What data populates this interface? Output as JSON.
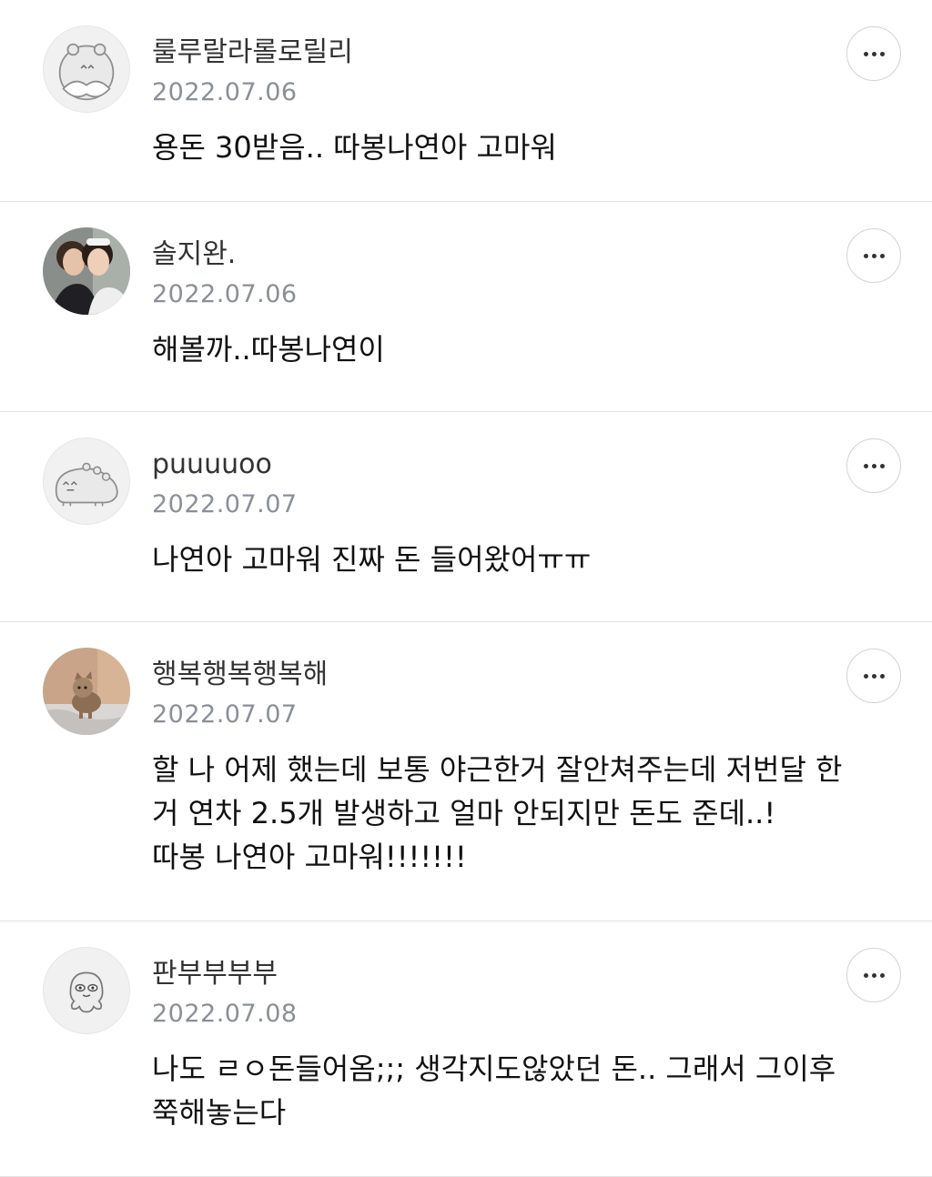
{
  "comments": [
    {
      "username": "룰루랄라롤로릴리",
      "date": "2022.07.06",
      "text_lines": [
        "용돈 30받음.. 따봉나연아 고마워"
      ],
      "avatar": "hamster-default-avatar"
    },
    {
      "username": "솔지완.",
      "date": "2022.07.06",
      "text_lines": [
        "해볼까..따봉나연이"
      ],
      "avatar": "photo-two-people-avatar"
    },
    {
      "username": "puuuuoo",
      "date": "2022.07.07",
      "text_lines": [
        "나연아 고마워 진짜 돈 들어왔어ㅠㅠ"
      ],
      "avatar": "hedgehog-default-avatar"
    },
    {
      "username": "행복행복행복해",
      "date": "2022.07.07",
      "text_lines": [
        "할 나 어제 했는데 보통 야근한거 잘안쳐주는데 저번달 한",
        "거 연차 2.5개 발생하고 얼마 안되지만 돈도 준데..!",
        "따봉 나연아 고마워!!!!!!!"
      ],
      "avatar": "photo-cat-avatar"
    },
    {
      "username": "판부부부부",
      "date": "2022.07.08",
      "text_lines": [
        "나도 ㄹㅇ돈들어옴;;; 생각지도않았던 돈.. 그래서 그이후",
        "쭉해놓는다"
      ],
      "avatar": "octopus-default-avatar"
    }
  ]
}
